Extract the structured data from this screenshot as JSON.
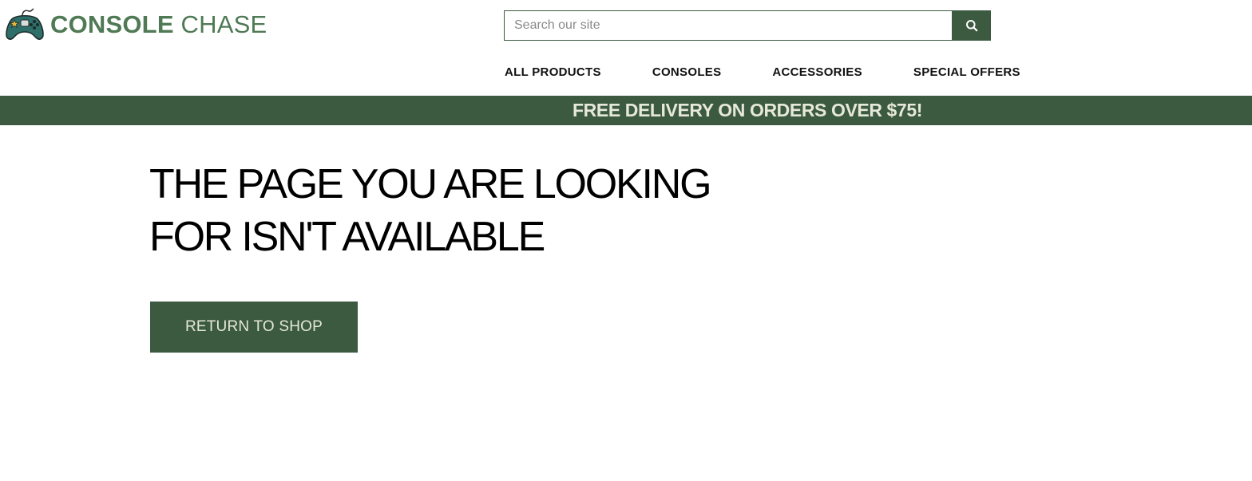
{
  "header": {
    "logo": {
      "icon": "gamepad-icon",
      "text_bold": "CONSOLE",
      "text_light": "CHASE"
    },
    "search": {
      "placeholder": "Search our site",
      "value": "",
      "button_icon": "search-icon"
    },
    "nav": [
      {
        "label": "ALL PRODUCTS"
      },
      {
        "label": "CONSOLES"
      },
      {
        "label": "ACCESSORIES"
      },
      {
        "label": "SPECIAL OFFERS"
      }
    ]
  },
  "promo": {
    "text": "FREE DELIVERY ON ORDERS OVER $75!"
  },
  "main": {
    "heading_line1": "THE PAGE YOU ARE LOOKING",
    "heading_line2": "FOR ISN'T AVAILABLE",
    "cta_label": "RETURN TO SHOP"
  },
  "colors": {
    "brand_green": "#3b5a40",
    "logo_green": "#4f7a55",
    "promo_text": "#e6e8d8",
    "gamepad_body": "#2f6f6a",
    "gamepad_star": "#e8b838"
  }
}
